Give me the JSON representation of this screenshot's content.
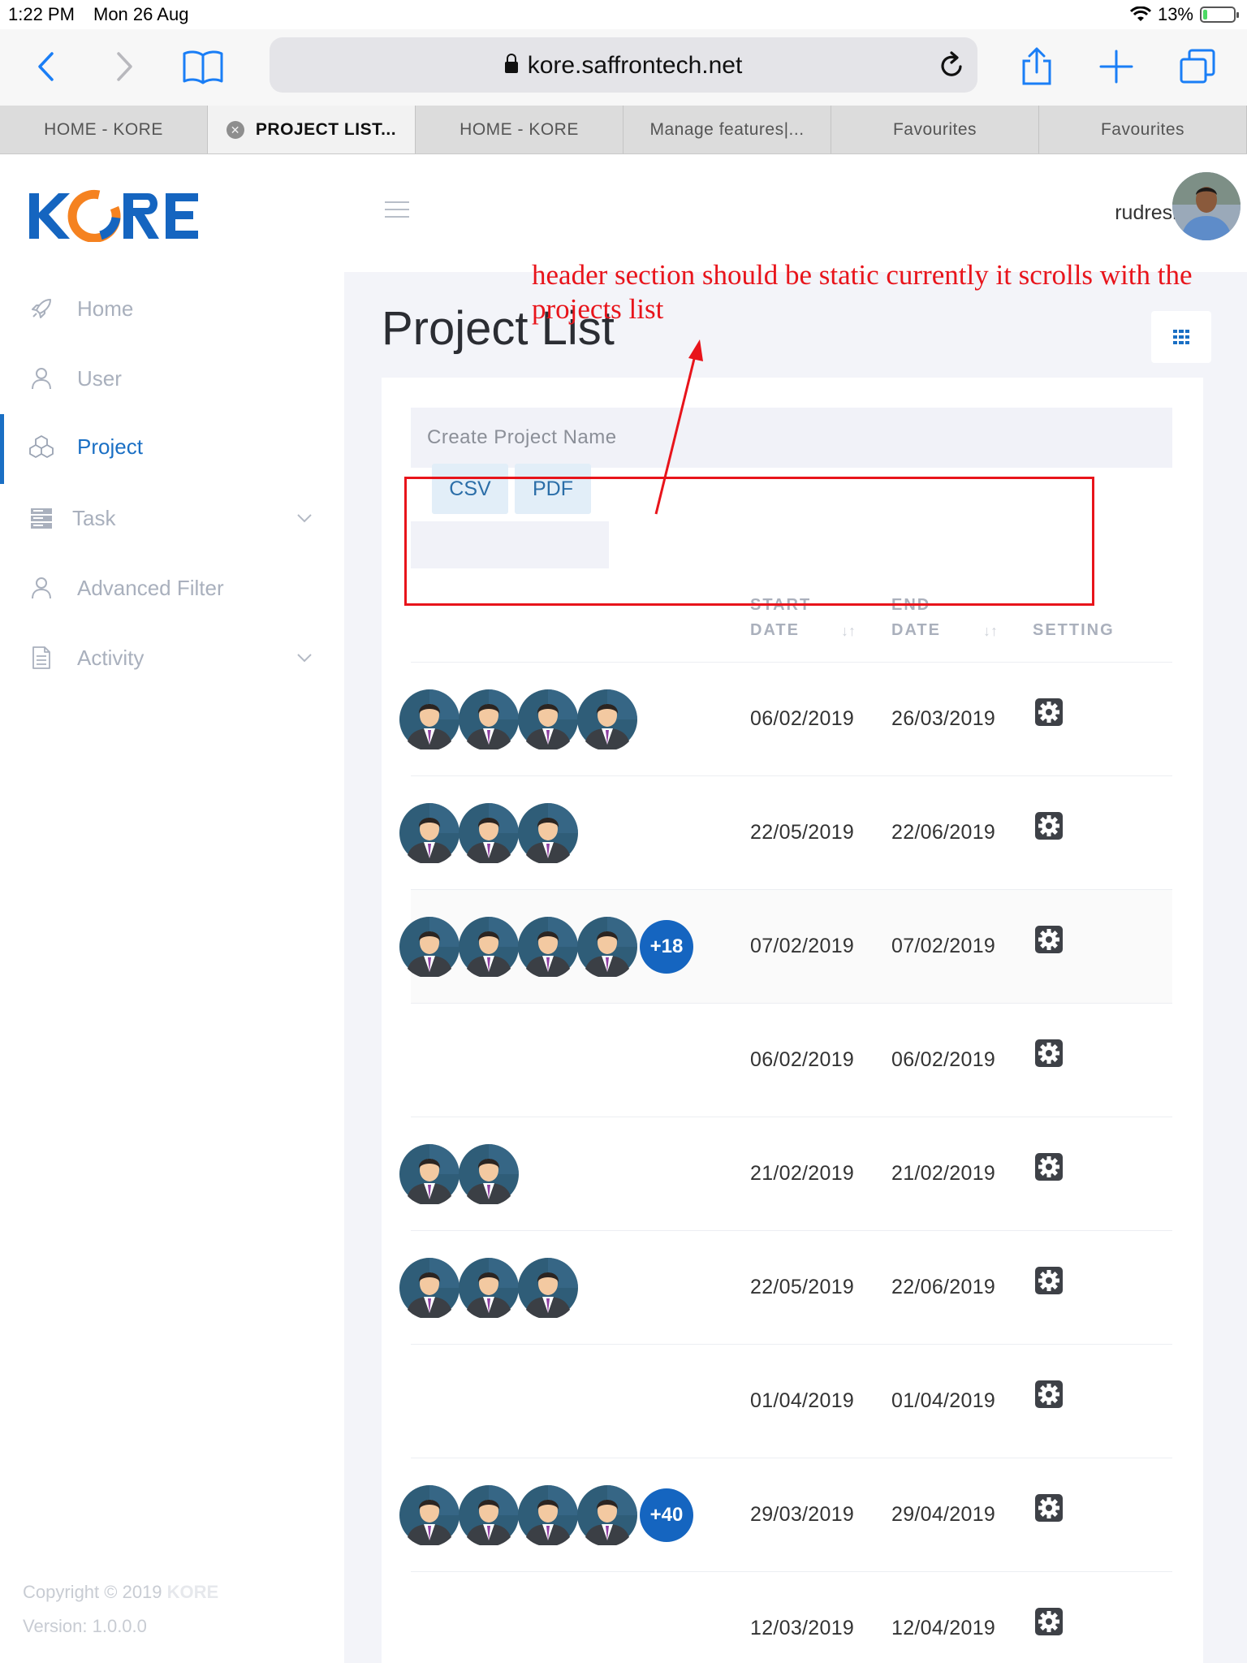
{
  "status": {
    "time": "1:22 PM",
    "date": "Mon 26 Aug",
    "battery": "13%",
    "battery_fraction": 0.13
  },
  "browser": {
    "url": "kore.saffrontech.net",
    "tabs": [
      {
        "label": "HOME - KORE"
      },
      {
        "label": "PROJECT LIST..."
      },
      {
        "label": "HOME - KORE"
      },
      {
        "label": "Manage features|..."
      },
      {
        "label": "Favourites"
      },
      {
        "label": "Favourites"
      }
    ],
    "active_tab": 1
  },
  "sidebar": {
    "logo": "KORE",
    "items": [
      {
        "label": "Home",
        "icon": "rocket-icon"
      },
      {
        "label": "User",
        "icon": "user-icon"
      },
      {
        "label": "Project",
        "icon": "cubes-icon",
        "active": true
      },
      {
        "label": "Task",
        "icon": "server-icon",
        "has_chevron": true
      },
      {
        "label": "Advanced Filter",
        "icon": "user-icon"
      },
      {
        "label": "Activity",
        "icon": "document-icon",
        "has_chevron": true
      }
    ],
    "copyright": "Copyright © 2019",
    "copyright_brand": "KORE",
    "version": "Version: 1.0.0.0"
  },
  "header": {
    "username": "rudresh"
  },
  "page": {
    "title": "Project List",
    "create_placeholder": "Create Project Name",
    "csv_label": "CSV",
    "pdf_label": "PDF",
    "columns": {
      "start_1": "START",
      "start_2": "DATE",
      "end_1": "END",
      "end_2": "DATE",
      "setting": "SETTING"
    },
    "rows": [
      {
        "avatars": 4,
        "more": "",
        "start": "06/02/2019",
        "end": "26/03/2019"
      },
      {
        "avatars": 3,
        "more": "",
        "start": "22/05/2019",
        "end": "22/06/2019"
      },
      {
        "avatars": 4,
        "more": "+18",
        "start": "07/02/2019",
        "end": "07/02/2019"
      },
      {
        "avatars": 0,
        "more": "",
        "start": "06/02/2019",
        "end": "06/02/2019"
      },
      {
        "avatars": 2,
        "more": "",
        "start": "21/02/2019",
        "end": "21/02/2019"
      },
      {
        "avatars": 3,
        "more": "",
        "start": "22/05/2019",
        "end": "22/06/2019"
      },
      {
        "avatars": 0,
        "more": "",
        "start": "01/04/2019",
        "end": "01/04/2019"
      },
      {
        "avatars": 4,
        "more": "+40",
        "start": "29/03/2019",
        "end": "29/04/2019"
      },
      {
        "avatars": 0,
        "more": "",
        "start": "12/03/2019",
        "end": "12/04/2019"
      }
    ]
  },
  "annotation": {
    "text": "header section should be static currently it scrolls with the projects list",
    "color": "#e8141b"
  },
  "colors": {
    "accent": "#1a6fc4",
    "logo_blue": "#1565c0",
    "logo_orange": "#f58220",
    "badge": "#1565c0"
  }
}
